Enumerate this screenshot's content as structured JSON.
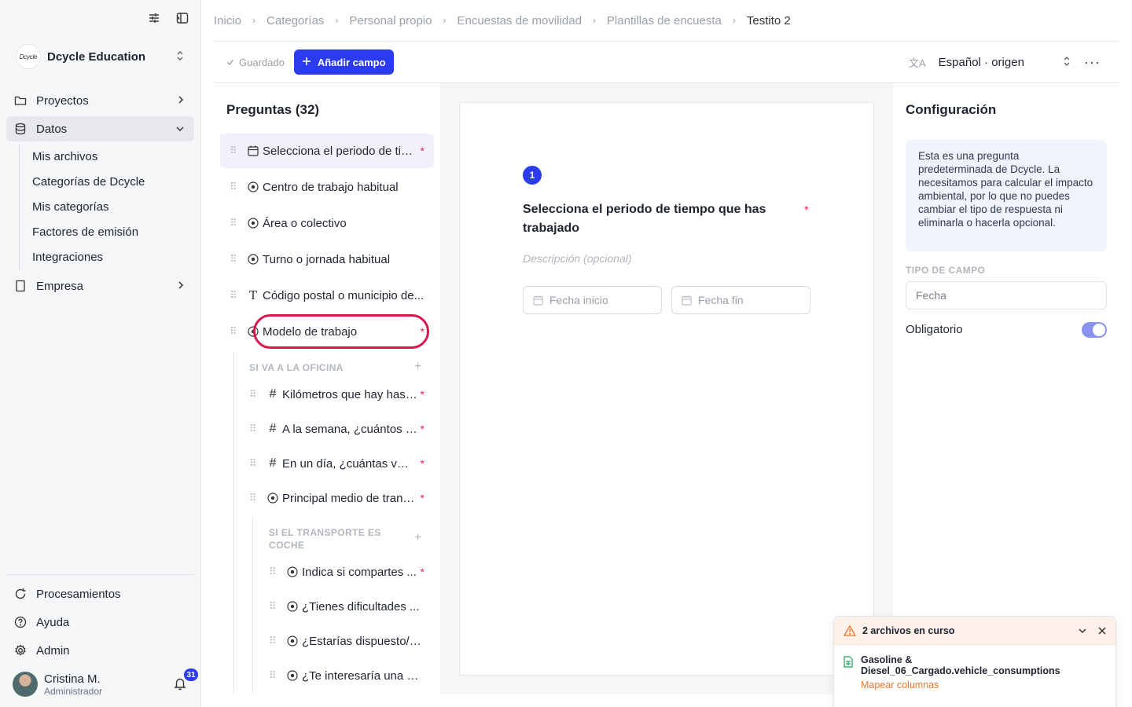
{
  "sidebar": {
    "org_name": "Dcycle Education",
    "org_logo_text": "Dcycle",
    "nav": {
      "proyectos": "Proyectos",
      "datos": "Datos",
      "empresa": "Empresa"
    },
    "datos_sub": [
      "Mis archivos",
      "Categorías de Dcycle",
      "Mis categorías",
      "Factores de emisión",
      "Integraciones"
    ],
    "bottom": [
      "Procesamientos",
      "Ayuda",
      "Admin"
    ],
    "user": {
      "name": "Cristina M.",
      "role": "Administrador",
      "notifications": "31"
    }
  },
  "breadcrumb": [
    "Inicio",
    "Categorías",
    "Personal propio",
    "Encuestas de movilidad",
    "Plantillas de encuesta",
    "Testito 2"
  ],
  "toolbar": {
    "saved_label": "Guardado",
    "add_field_label": "Añadir campo",
    "language": "Español · origen"
  },
  "questions": {
    "title": "Preguntas (32)",
    "items": [
      {
        "text": "Selecciona el periodo de tie...",
        "icon": "calendar-icon",
        "required": "*"
      },
      {
        "text": "Centro de trabajo habitual",
        "icon": "radio-icon",
        "required": ""
      },
      {
        "text": "Área o colectivo",
        "icon": "radio-icon",
        "required": ""
      },
      {
        "text": "Turno o jornada habitual",
        "icon": "radio-icon",
        "required": ""
      },
      {
        "text": "Código postal o municipio de...",
        "icon": "text-icon",
        "required": ""
      },
      {
        "text": "Modelo de trabajo",
        "icon": "radio-icon",
        "required": "*"
      }
    ],
    "group1": {
      "label": "SI VA A LA OFICINA",
      "items": [
        {
          "text": "Kilómetros que hay hast...",
          "icon": "hash-icon",
          "required": "*"
        },
        {
          "text": "A la semana, ¿cuántos d...",
          "icon": "hash-icon",
          "required": "*"
        },
        {
          "text": "En un día, ¿cuántas vec...",
          "icon": "hash-icon",
          "required": "*"
        },
        {
          "text": "Principal medio de trans...",
          "icon": "radio-icon",
          "required": "*"
        }
      ]
    },
    "group2": {
      "label_line1": "SI EL TRANSPORTE ES",
      "label_line2": "COCHE",
      "items": [
        {
          "text": "Indica si compartes ...",
          "icon": "radio-icon",
          "required": "*"
        },
        {
          "text": "¿Tienes dificultades ...",
          "icon": "radio-icon",
          "required": ""
        },
        {
          "text": "¿Estarías dispuesto/a...",
          "icon": "radio-icon",
          "required": ""
        },
        {
          "text": "¿Te interesaría una h...",
          "icon": "radio-icon",
          "required": ""
        }
      ]
    }
  },
  "editor": {
    "number": "1",
    "question": "Selecciona el periodo de tiempo que has trabajado",
    "required": "*",
    "description_placeholder": "Descripción (opcional)",
    "start_placeholder": "Fecha inicio",
    "end_placeholder": "Fecha fin"
  },
  "config": {
    "title": "Configuración",
    "info": "Esta es una pregunta predeterminada de Dcycle. La necesitamos para calcular el impacto ambiental, por lo que no puedes cambiar el tipo de respuesta ni eliminarla o hacerla opcional.",
    "field_type_label": "TIPO DE CAMPO",
    "field_type_value": "Fecha",
    "required_label": "Obligatorio",
    "required_on": true
  },
  "toast": {
    "title": "2 archivos en curso",
    "file_name": "Gasoline & Diesel_06_Cargado.vehicle_consumptions",
    "action": "Mapear columnas"
  },
  "colors": {
    "accent": "#2b3cf0",
    "required": "#e0245e",
    "warning": "#e8772e",
    "highlight_ring": "#d9174c"
  }
}
